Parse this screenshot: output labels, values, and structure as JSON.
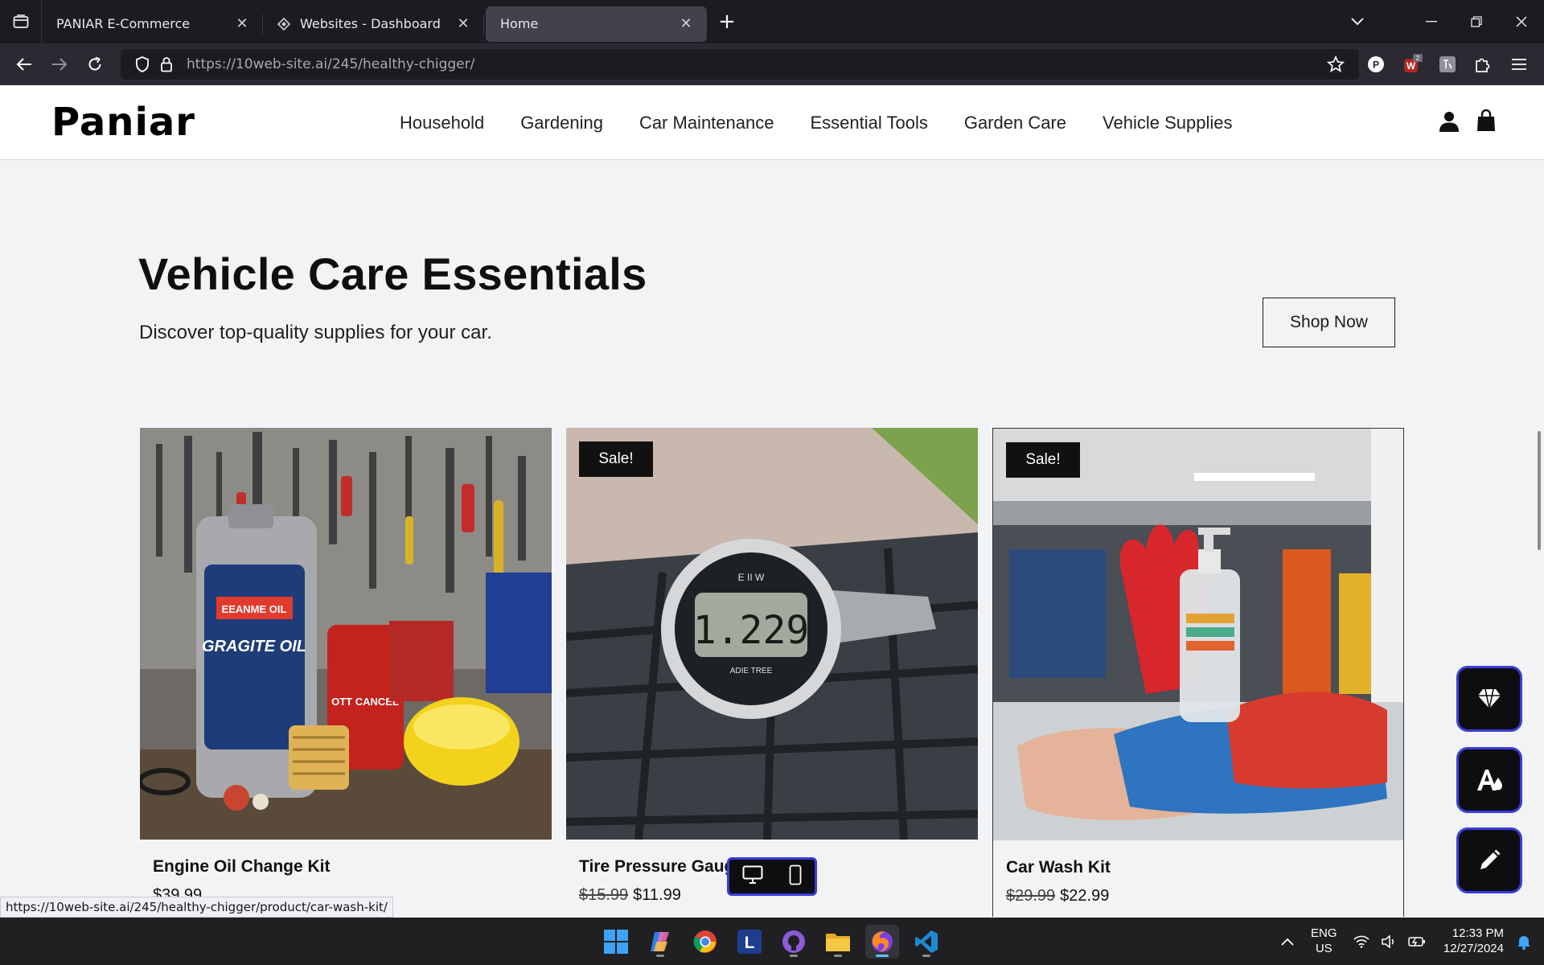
{
  "browser": {
    "tabs": [
      {
        "title": "PANIAR E-Commerce",
        "active": false
      },
      {
        "title": "Websites - Dashboard",
        "active": false
      },
      {
        "title": "Home",
        "active": true
      }
    ],
    "url_host": "https://10web-site.ai",
    "url_path": "/245/healthy-chigger/",
    "extension_badge": "2",
    "status_url": "https://10web-site.ai/245/healthy-chigger/product/car-wash-kit/"
  },
  "site": {
    "logo": "Paniar",
    "menu": [
      "Household",
      "Gardening",
      "Car Maintenance",
      "Essential Tools",
      "Garden Care",
      "Vehicle Supplies"
    ]
  },
  "hero": {
    "title": "Vehicle Care Essentials",
    "subtitle": "Discover top-quality supplies for your car.",
    "cta": "Shop Now"
  },
  "products": [
    {
      "name": "Engine Oil Change Kit",
      "old_price": "",
      "price": "$39.99",
      "sale": false
    },
    {
      "name": "Tire Pressure Gauge",
      "old_price": "$15.99",
      "price": "$11.99",
      "sale": true,
      "sale_label": "Sale!"
    },
    {
      "name": "Car Wash Kit",
      "old_price": "$29.99",
      "price": "$22.99",
      "sale": true,
      "sale_label": "Sale!"
    }
  ],
  "taskbar": {
    "lang": "ENG",
    "region": "US",
    "time": "12:33 PM",
    "date": "12/27/2024"
  },
  "colors": {
    "accent": "#3b3cd8",
    "chrome_dark": "#1c1b22",
    "page_bg": "#f2f3f5"
  }
}
